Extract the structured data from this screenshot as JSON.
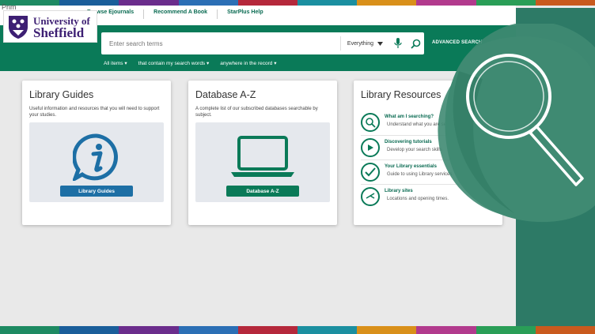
{
  "colors": {
    "stripes": [
      "#1e8a62",
      "#1a5e9a",
      "#6b2d8c",
      "#2b6fb5",
      "#b5283b",
      "#1b8fa0",
      "#d9901a",
      "#b23a8d",
      "#2a9e57",
      "#c95a1e"
    ],
    "green": "#0a7a58",
    "blue_button": "#1d6fa5",
    "side_panel": "#2d7a66"
  },
  "corner_text": "Prim",
  "topnav": {
    "links": [
      "Browse Ejournals",
      "Recommend A Book",
      "StarPlus Help"
    ]
  },
  "logo": {
    "line1": "University of",
    "line2": "Sheffield"
  },
  "search": {
    "placeholder": "Enter search terms",
    "scope": "Everything",
    "advanced": "ADVANCED SEARCH",
    "filters": [
      "All items",
      "that contain my search words",
      "anywhere in the record"
    ]
  },
  "cards": [
    {
      "title": "Library Guides",
      "description": "Useful information and resources that you will need to support your studies.",
      "button": "Library Guides",
      "icon": "info-icon"
    },
    {
      "title": "Database A-Z",
      "description": "A complete list of our subscribed databases searchable by subject.",
      "button": "Database A-Z",
      "icon": "laptop-icon"
    },
    {
      "title": "Library Resources",
      "items": [
        {
          "title": "What am I searching?",
          "desc": "Understand what you are searching",
          "icon": "magnifier-icon"
        },
        {
          "title": "Discovering tutorials",
          "desc": "Develop your search skills",
          "icon": "play-icon"
        },
        {
          "title": "Your Library essentials",
          "desc": "Guide to using Library services",
          "icon": "check-icon"
        },
        {
          "title": "Library sites",
          "desc": "Locations and opening times.",
          "icon": "clock-icon"
        }
      ]
    }
  ]
}
